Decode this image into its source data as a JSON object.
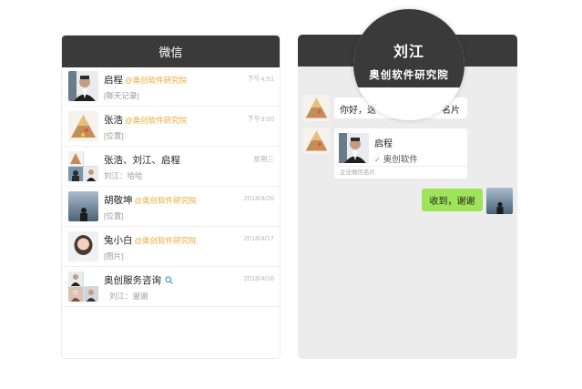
{
  "left": {
    "title": "微信",
    "chats": [
      {
        "name": "启程",
        "org": "@奥创软件研究院",
        "time": "下午4:51",
        "preview": "[聊天记录]"
      },
      {
        "name": "张浩",
        "org": "@奥创软件研究院",
        "time": "下午3:00",
        "preview": "[位置]"
      },
      {
        "name": "张浩、刘江、启程",
        "org": "",
        "time": "星期三",
        "preview": "刘江：哈哈"
      },
      {
        "name": "胡敬坤",
        "org": "@奥创软件研究院",
        "time": "2018/4/26",
        "preview": "[位置]"
      },
      {
        "name": "兔小白",
        "org": "@奥创软件研究院",
        "time": "2018/4/17",
        "preview": "[图片]"
      },
      {
        "name": "奥创服务咨询",
        "org": "",
        "time": "2018/4/16",
        "preview": "刘江：谢谢"
      }
    ]
  },
  "right": {
    "magnifier": {
      "name": "刘江",
      "org": "奥创软件研究院"
    },
    "message1_visible": "你好，这",
    "message1_tail": "名片",
    "card": {
      "name": "启程",
      "org": "奥创软件",
      "footer": "企业微信名片"
    },
    "reply": "收到，谢谢"
  },
  "colors": {
    "header": "#3a3a3a",
    "org": "#f0a93b",
    "bubble_out": "#9ee35a",
    "verified": "#2fae4a"
  }
}
